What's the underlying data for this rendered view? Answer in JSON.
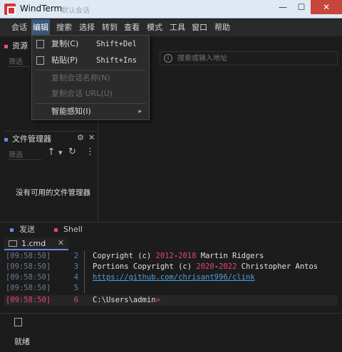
{
  "window": {
    "title": "WindTerm",
    "subtitle_blurred": "默认会话",
    "min": "—",
    "max": "☐",
    "close": "✕"
  },
  "menubar": [
    "会话",
    "编辑",
    "搜索",
    "选择",
    "转到",
    "查看",
    "模式",
    "工具",
    "窗口",
    "帮助"
  ],
  "edit_menu": {
    "copy": {
      "label": "复制(C)",
      "shortcut": "Shift+Del"
    },
    "paste": {
      "label": "粘贴(P)",
      "shortcut": "Shift+Ins"
    },
    "copy_session_name": {
      "label": "复制会话名称(N)"
    },
    "copy_session_url": {
      "label": "复制会话 URL(U)"
    },
    "smart_sense": {
      "label": "智能感知(I)",
      "arrow": "▸"
    }
  },
  "session_panel": {
    "title": "资源",
    "filter_placeholder": "筛选"
  },
  "address_bar": {
    "placeholder": "搜索或输入地址"
  },
  "file_manager": {
    "title": "文件管理器",
    "filter_placeholder": "筛选",
    "empty": "没有可用的文件管理器",
    "gear": "⚙",
    "close": "✕",
    "up": "↑",
    "down": "▾",
    "refresh": "↻",
    "more": "⋮"
  },
  "bottom_tabs": [
    {
      "label": "发送",
      "color": "#6a8ae0"
    },
    {
      "label": "Shell",
      "color": "#e0457a"
    }
  ],
  "terminal_tab": {
    "label": "1.cmd",
    "close": "✕"
  },
  "terminal": {
    "lines": [
      {
        "time": "[09:58:50]",
        "num": "2",
        "pre": "Copyright (c) ",
        "y1": "2012",
        "mid": "-",
        "y2": "2018",
        "post": " Martin Ridgers"
      },
      {
        "time": "[09:58:50]",
        "num": "3",
        "pre": "Portions Copyright (c) ",
        "y1": "2020",
        "mid": "-",
        "y2": "2022",
        "post": " Christopher Antos"
      },
      {
        "time": "[09:58:50]",
        "num": "4",
        "link": "https://github.com/chrisant996/clink"
      },
      {
        "time": "[09:58:50]",
        "num": "5"
      },
      {
        "time": "[09:58:50]",
        "num": "6",
        "path": "C:\\Users\\admin",
        "prompt": ">"
      }
    ]
  },
  "status": {
    "text": "就绪"
  }
}
